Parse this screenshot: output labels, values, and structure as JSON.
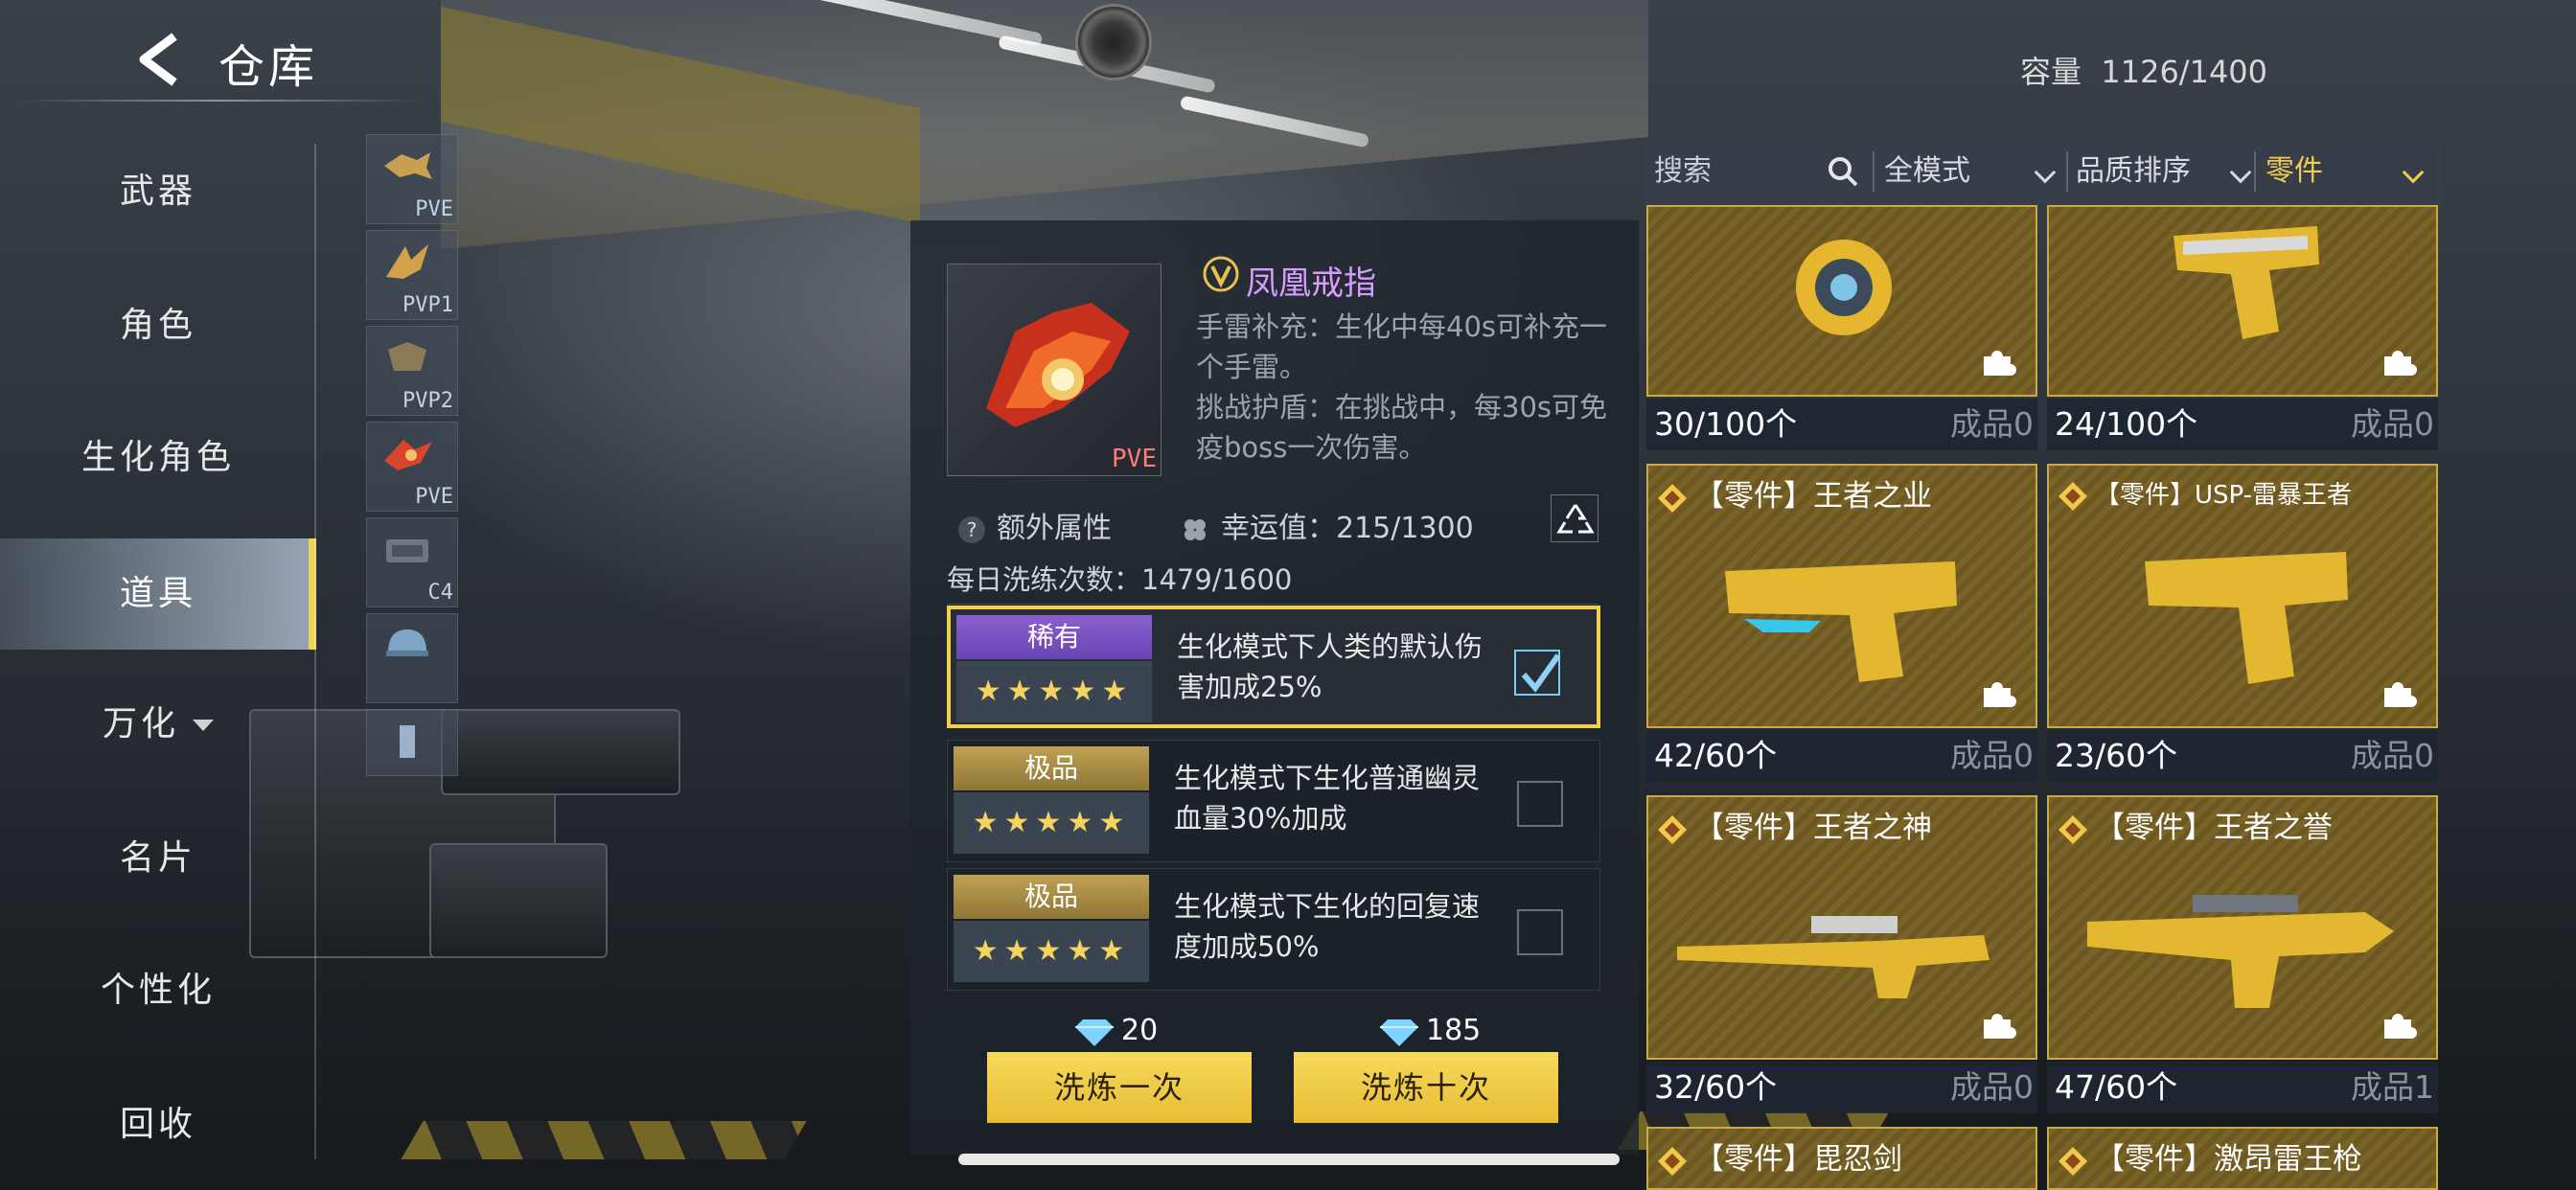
{
  "header": {
    "title": "仓库",
    "capacity_label": "容量",
    "capacity_value": "1126/1400"
  },
  "sidebar": {
    "items": [
      {
        "label": "武器"
      },
      {
        "label": "角色"
      },
      {
        "label": "生化角色"
      },
      {
        "label": "道具",
        "active": true
      },
      {
        "label": "万化",
        "has_dropdown": true
      },
      {
        "label": "名片"
      },
      {
        "label": "个性化"
      },
      {
        "label": "回收"
      }
    ]
  },
  "subcategories": [
    {
      "tag": "PVE"
    },
    {
      "tag": "PVP1"
    },
    {
      "tag": "PVP2"
    },
    {
      "tag": "PVE"
    },
    {
      "tag": "C4"
    },
    {
      "tag": ""
    },
    {
      "tag": ""
    }
  ],
  "detail": {
    "item_name": "凤凰戒指",
    "item_badge": "PVE",
    "description_line1": "手雷补充：生化中每40s可补充一个手雷。",
    "description_line2": "挑战护盾：在挑战中，每30s可免疫boss一次伤害。",
    "extra_attr_label": "额外属性",
    "luck_label": "幸运值：215/1300",
    "daily_label": "每日洗练次数：1479/1600",
    "options": [
      {
        "grade": "稀有",
        "stars": "★★★★★",
        "desc": "生化模式下人类的默认伤害加成25%",
        "selected": true
      },
      {
        "grade": "极品",
        "stars": "★★★★★",
        "desc": "生化模式下生化普通幽灵血量30%加成",
        "selected": false
      },
      {
        "grade": "极品",
        "stars": "★★★★★",
        "desc": "生化模式下生化的回复速度加成50%",
        "selected": false
      }
    ],
    "cost_once": "20",
    "cost_ten": "185",
    "btn_once": "洗炼一次",
    "btn_ten": "洗炼十次"
  },
  "filters": {
    "search_placeholder": "搜索",
    "mode": "全模式",
    "sort": "品质排序",
    "category": "零件"
  },
  "inventory": [
    {
      "title": "",
      "count": "30/100个",
      "finished": "成品0",
      "art": "grenade-icon"
    },
    {
      "title": "",
      "count": "24/100个",
      "finished": "成品0",
      "art": "pistol-icon"
    },
    {
      "title": "【零件】王者之业",
      "count": "42/60个",
      "finished": "成品0",
      "art": "pistol-icon"
    },
    {
      "title": "【零件】USP-雷暴王者",
      "count": "23/60个",
      "finished": "成品0",
      "art": "pistol-icon"
    },
    {
      "title": "【零件】王者之神",
      "count": "32/60个",
      "finished": "成品0",
      "art": "sniper-rifle-icon"
    },
    {
      "title": "【零件】王者之誉",
      "count": "47/60个",
      "finished": "成品1",
      "art": "assault-rifle-icon"
    },
    {
      "title": "【零件】毘忍剑",
      "count": "",
      "finished": "",
      "art": ""
    },
    {
      "title": "【零件】激昂雷王枪",
      "count": "",
      "finished": "",
      "art": ""
    }
  ],
  "colors": {
    "accent_gold": "#f3cf4e",
    "rare_purple": "#8a5fd0",
    "item_name": "#d89cff",
    "button": "#f7d95c"
  }
}
